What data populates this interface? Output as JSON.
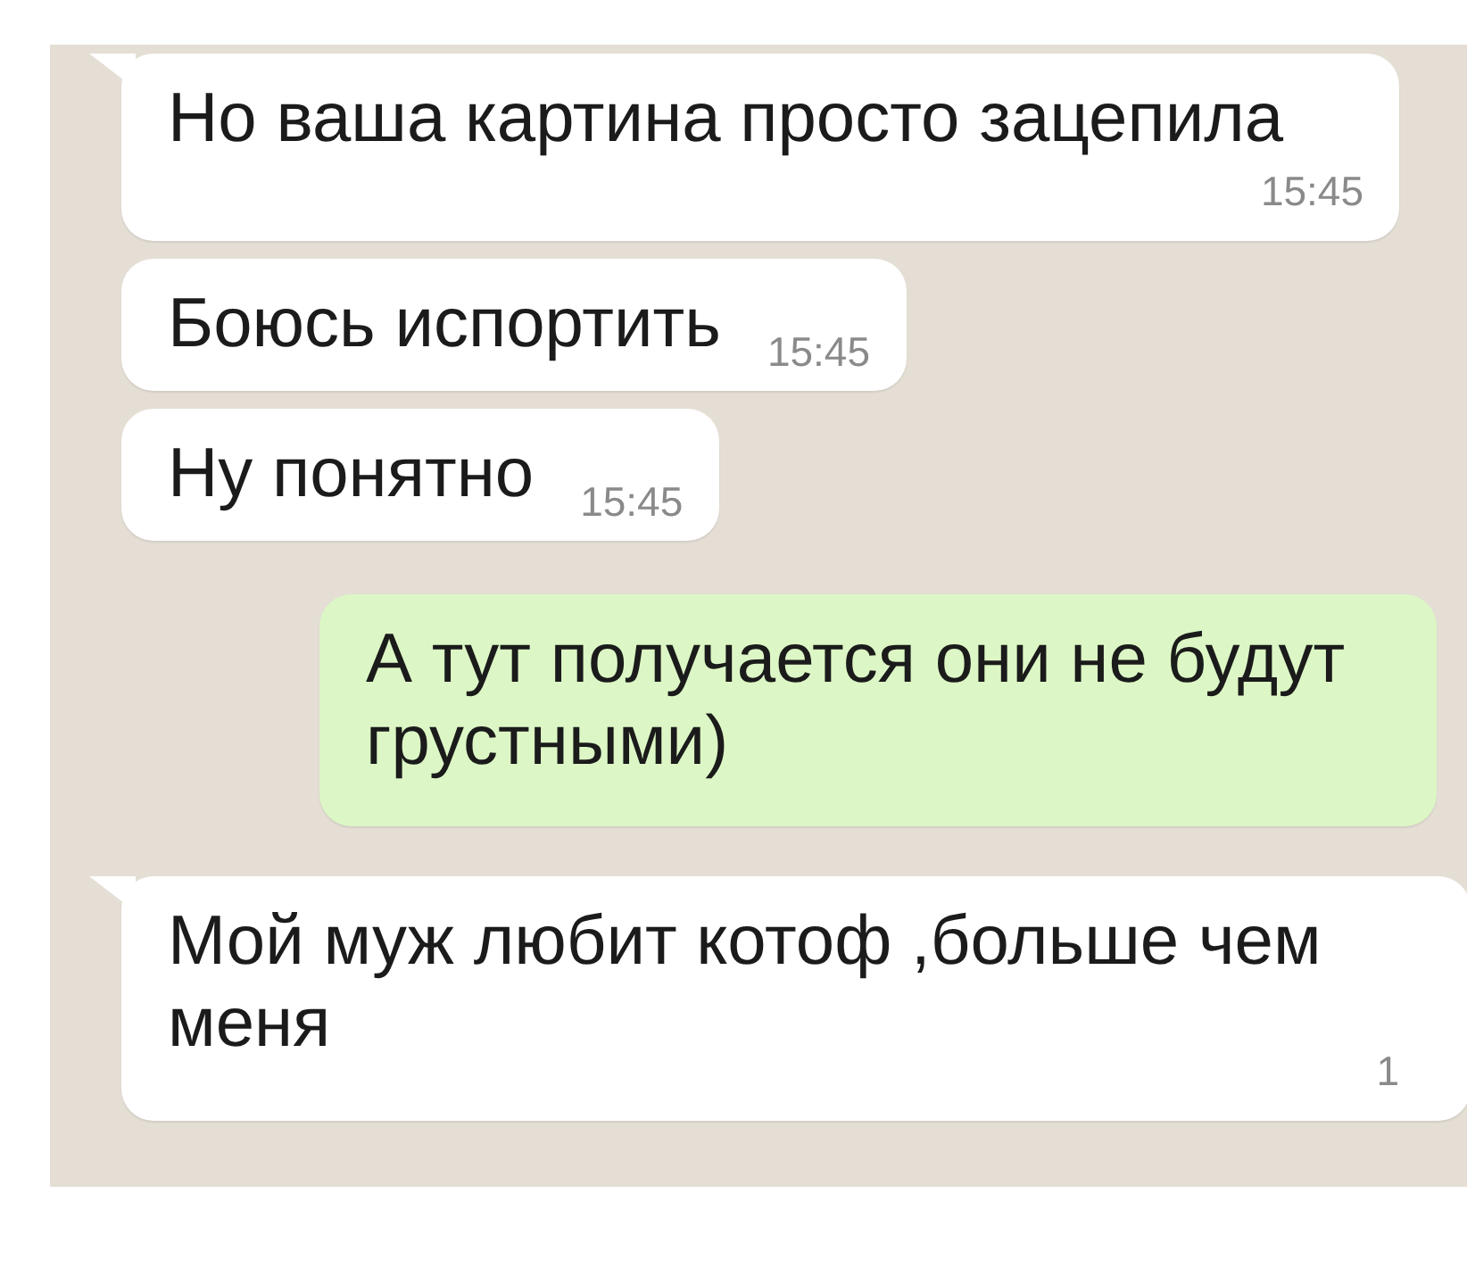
{
  "messages": [
    {
      "kind": "incoming",
      "text": "Но ваша картина просто зацепила",
      "time": "15:45",
      "tail": true
    },
    {
      "kind": "incoming",
      "text": "Боюсь испортить",
      "time": "15:45",
      "tail": false
    },
    {
      "kind": "incoming",
      "text": "Ну понятно",
      "time": "15:45",
      "tail": false
    },
    {
      "kind": "outgoing",
      "text": "А тут получается они не будут грустными)",
      "tail": false
    },
    {
      "kind": "incoming",
      "text": "Мой муж любит котоф ,больше чем меня",
      "time": "1",
      "tail": true
    }
  ]
}
